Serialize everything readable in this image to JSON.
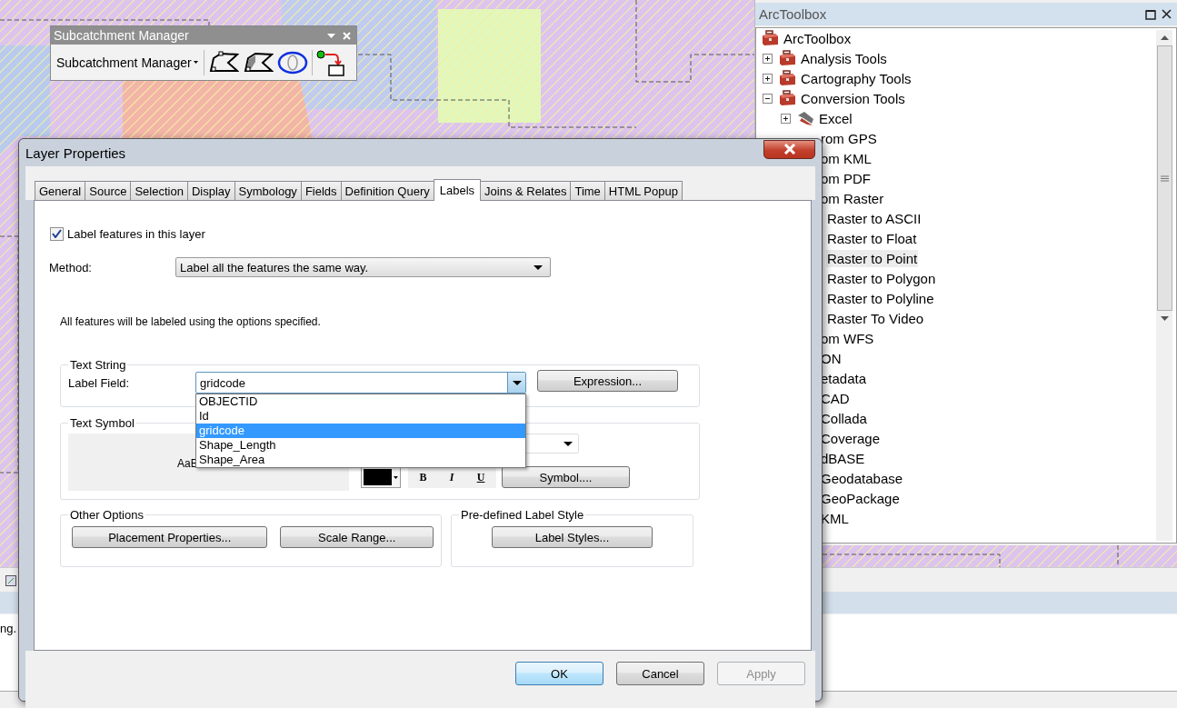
{
  "toolbar_window": {
    "title": "Subcatchment Manager",
    "menu": "Subcatchment Manager"
  },
  "toolbox": {
    "title": "ArcToolbox",
    "tree": [
      {
        "label": "ArcToolbox",
        "kind": "root",
        "children": [
          {
            "label": "Analysis Tools",
            "kind": "toolbox",
            "expanded": false
          },
          {
            "label": "Cartography Tools",
            "kind": "toolbox",
            "expanded": false
          },
          {
            "label": "Conversion Tools",
            "kind": "toolbox",
            "expanded": true,
            "children": [
              {
                "label": "Excel",
                "kind": "toolset",
                "expanded": false,
                "hovered": false
              },
              {
                "label": "rom GPS",
                "kind": "partial",
                "hovered": false
              },
              {
                "label": "om KML",
                "kind": "partial",
                "hovered": false
              },
              {
                "label": "om PDF",
                "kind": "partial",
                "hovered": false
              },
              {
                "label": "om Raster",
                "kind": "partial",
                "hovered": false,
                "children": [
                  {
                    "label": "Raster to ASCII",
                    "kind": "partial",
                    "hovered": false
                  },
                  {
                    "label": "Raster to Float",
                    "kind": "partial",
                    "hovered": false
                  },
                  {
                    "label": "Raster to Point",
                    "kind": "partial",
                    "hovered": true
                  },
                  {
                    "label": "Raster to Polygon",
                    "kind": "partial",
                    "hovered": false
                  },
                  {
                    "label": "Raster to Polyline",
                    "kind": "partial",
                    "hovered": false
                  },
                  {
                    "label": "Raster To Video",
                    "kind": "partial",
                    "hovered": false
                  }
                ]
              },
              {
                "label": "om WFS",
                "kind": "partial",
                "hovered": false
              },
              {
                "label": "ON",
                "kind": "partial",
                "hovered": false
              },
              {
                "label": "etadata",
                "kind": "partial",
                "hovered": false
              },
              {
                "label": "CAD",
                "kind": "partial",
                "hovered": false
              },
              {
                "label": "Collada",
                "kind": "partial",
                "hovered": false
              },
              {
                "label": "Coverage",
                "kind": "partial",
                "hovered": false
              },
              {
                "label": "dBASE",
                "kind": "partial",
                "hovered": false
              },
              {
                "label": "Geodatabase",
                "kind": "partial",
                "hovered": false
              },
              {
                "label": "GeoPackage",
                "kind": "partial",
                "hovered": false
              },
              {
                "label": "KML",
                "kind": "partial",
                "hovered": false
              }
            ]
          }
        ]
      }
    ]
  },
  "status_text": "ng.",
  "dialog": {
    "title": "Layer Properties",
    "tabs": [
      {
        "label": "General",
        "selected": false
      },
      {
        "label": "Source",
        "selected": false
      },
      {
        "label": "Selection",
        "selected": false
      },
      {
        "label": "Display",
        "selected": false
      },
      {
        "label": "Symbology",
        "selected": false
      },
      {
        "label": "Fields",
        "selected": false
      },
      {
        "label": "Definition Query",
        "selected": false
      },
      {
        "label": "Labels",
        "selected": true
      },
      {
        "label": "Joins & Relates",
        "selected": false
      },
      {
        "label": "Time",
        "selected": false
      },
      {
        "label": "HTML Popup",
        "selected": false
      }
    ],
    "label_features": {
      "label": "Label features in this layer",
      "checked": true
    },
    "method": {
      "label": "Method:",
      "value": "Label all the features the same way."
    },
    "note": "All features will be labeled using the options specified.",
    "text_string": {
      "legend": "Text String",
      "label": "Label Field:",
      "value": "gridcode",
      "button": "Expression...",
      "options": [
        {
          "label": "OBJECTID",
          "selected": false
        },
        {
          "label": "Id",
          "selected": false
        },
        {
          "label": "gridcode",
          "selected": true
        },
        {
          "label": "Shape_Length",
          "selected": false
        },
        {
          "label": "Shape_Area",
          "selected": false
        }
      ]
    },
    "text_symbol": {
      "legend": "Text Symbol",
      "preview": "AaB",
      "style_buttons": [
        "B",
        "I",
        "U"
      ],
      "button": "Symbol...."
    },
    "other_options": {
      "legend": "Other Options",
      "buttons": [
        "Placement Properties...",
        "Scale Range..."
      ]
    },
    "predefined": {
      "legend": "Pre-defined Label Style",
      "button": "Label Styles..."
    },
    "buttons": [
      {
        "label": "OK",
        "default": true,
        "disabled": false
      },
      {
        "label": "Cancel",
        "default": false,
        "disabled": false
      },
      {
        "label": "Apply",
        "default": false,
        "disabled": true
      }
    ]
  }
}
